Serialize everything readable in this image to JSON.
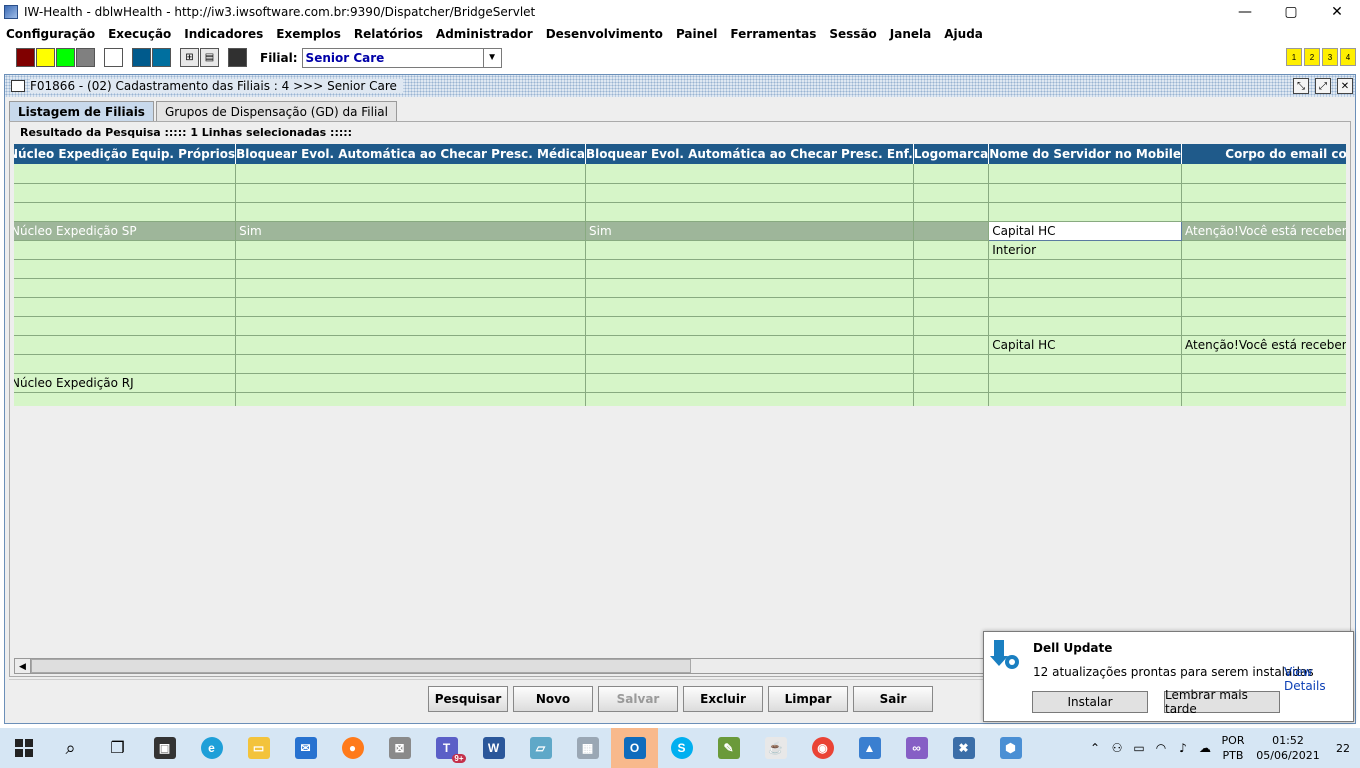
{
  "window": {
    "title": "IW-Health - dblwHealth - http://iw3.iwsoftware.com.br:9390/Dispatcher/BridgeServlet",
    "minimize": "—",
    "maximize": "▢",
    "close": "✕"
  },
  "menu": [
    "Configuração",
    "Execução",
    "Indicadores",
    "Exemplos",
    "Relatórios",
    "Administrador",
    "Desenvolvimento",
    "Painel",
    "Ferramentas",
    "Sessão",
    "Janela",
    "Ajuda"
  ],
  "toolbar": {
    "swatch_colors": [
      "#800000",
      "#ffff00",
      "#00ff00",
      "#808080"
    ],
    "swatch_white": "#ffffff",
    "swatch_blues": [
      "#005a8c",
      "#006f9f"
    ],
    "swatch_dark": "#303030",
    "filial_label": "Filial:",
    "filial_value": "Senior Care",
    "num_buttons": [
      "1",
      "2",
      "3",
      "4"
    ]
  },
  "frame": {
    "title": "F01866 - (02) Cadastramento das Filiais : 4 >>> Senior Care",
    "tabs": [
      "Listagem de  Filiais",
      "Grupos de Dispensação (GD) da Filial"
    ],
    "group_label": "Resultado da Pesquisa ::::: 1 Linhas selecionadas :::::"
  },
  "grid": {
    "columns": [
      "Núcleo Expedição Equip. Próprios",
      "Bloquear Evol. Automática ao Checar Presc. Médica",
      "Bloquear Evol. Automática ao Checar Presc. Enf.",
      "Logomarca",
      "Nome do Servidor no Mobile",
      "Corpo do email contendo a chave servidor Mobile"
    ],
    "rows": [
      [
        "",
        "",
        "",
        "",
        "",
        ""
      ],
      [
        "",
        "",
        "",
        "",
        "",
        ""
      ],
      [
        "",
        "",
        "",
        "",
        "",
        ""
      ],
      [
        "Núcleo Expedição SP",
        "Sim",
        "Sim",
        "",
        "Capital HC",
        "Atenção!Você está recebendo a chave de acesso ao IW-Health Mobile"
      ],
      [
        "",
        "",
        "",
        "",
        "Interior",
        ""
      ],
      [
        "",
        "",
        "",
        "",
        "",
        ""
      ],
      [
        "",
        "",
        "",
        "",
        "",
        ""
      ],
      [
        "",
        "",
        "",
        "",
        "",
        ""
      ],
      [
        "",
        "",
        "",
        "",
        "",
        ""
      ],
      [
        "",
        "",
        "",
        "",
        "Capital HC",
        "Atenção!Você está recebendo a chave de acesso ao IW-Health Mobile"
      ],
      [
        "",
        "",
        "",
        "",
        "",
        ""
      ],
      [
        "Núcleo Expedição RJ",
        "",
        "",
        "",
        "",
        ""
      ],
      [
        "",
        "",
        "",
        "",
        "",
        ""
      ]
    ],
    "selected_row": 3
  },
  "actions": {
    "pesquisar": "Pesquisar",
    "novo": "Novo",
    "salvar": "Salvar",
    "excluir": "Excluir",
    "limpar": "Limpar",
    "sair": "Sair"
  },
  "notification": {
    "title": "Dell Update",
    "message": "12 atualizações prontas para serem instaladas",
    "link": "View Details",
    "install": "Instalar",
    "remind": "Lembrar mais tarde"
  },
  "taskbar": {
    "lang1": "POR",
    "lang2": "PTB",
    "time": "01:52",
    "date": "05/06/2021",
    "notifications": "22",
    "teams_badge": "9+"
  }
}
